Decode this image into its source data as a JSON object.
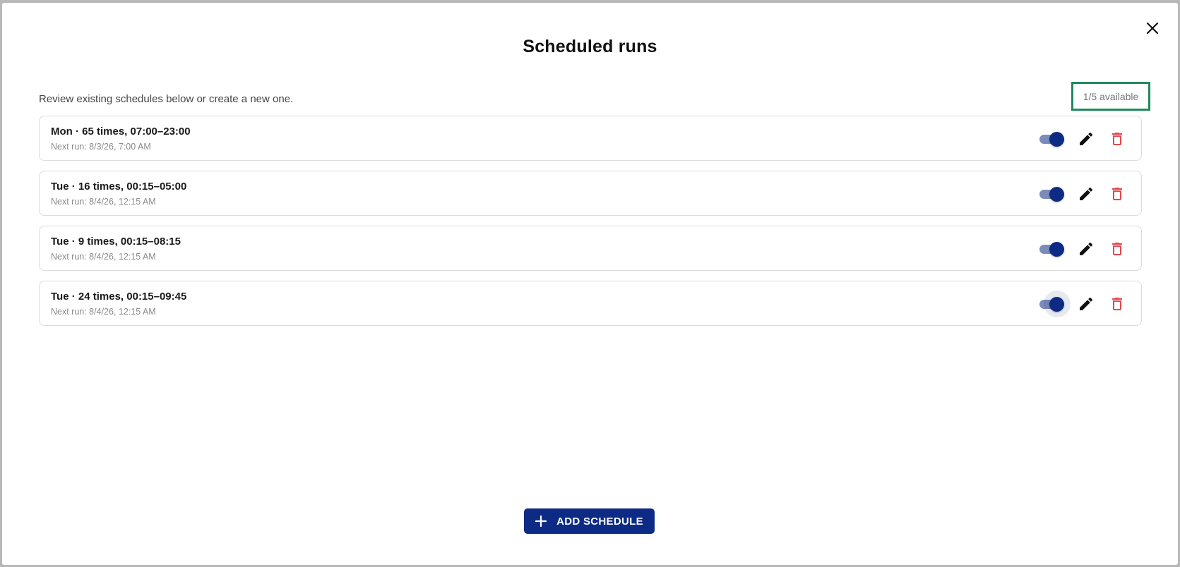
{
  "dialog": {
    "title": "Scheduled runs",
    "subtitle": "Review existing schedules below or create a new one.",
    "available": "1/5 available"
  },
  "schedules": [
    {
      "summary": "Mon · 65 times, 07:00–23:00",
      "next_run": "Next run: 8/3/26, 7:00 AM",
      "enabled": true
    },
    {
      "summary": "Tue · 16 times, 00:15–05:00",
      "next_run": "Next run: 8/4/26, 12:15 AM",
      "enabled": true
    },
    {
      "summary": "Tue · 9 times, 00:15–08:15",
      "next_run": "Next run: 8/4/26, 12:15 AM",
      "enabled": true
    },
    {
      "summary": "Tue · 24 times, 00:15–09:45",
      "next_run": "Next run: 8/4/26, 12:15 AM",
      "enabled": true
    }
  ],
  "actions": {
    "add_label": "ADD SCHEDULE"
  },
  "colors": {
    "primary": "#0d2b84",
    "toggle_track": "#7b8cba",
    "delete": "#e0484f",
    "highlight_border": "#1e8a5a"
  },
  "icons": {
    "close": "close-icon",
    "edit": "pencil-icon",
    "delete": "trash-icon",
    "add": "plus-icon"
  }
}
